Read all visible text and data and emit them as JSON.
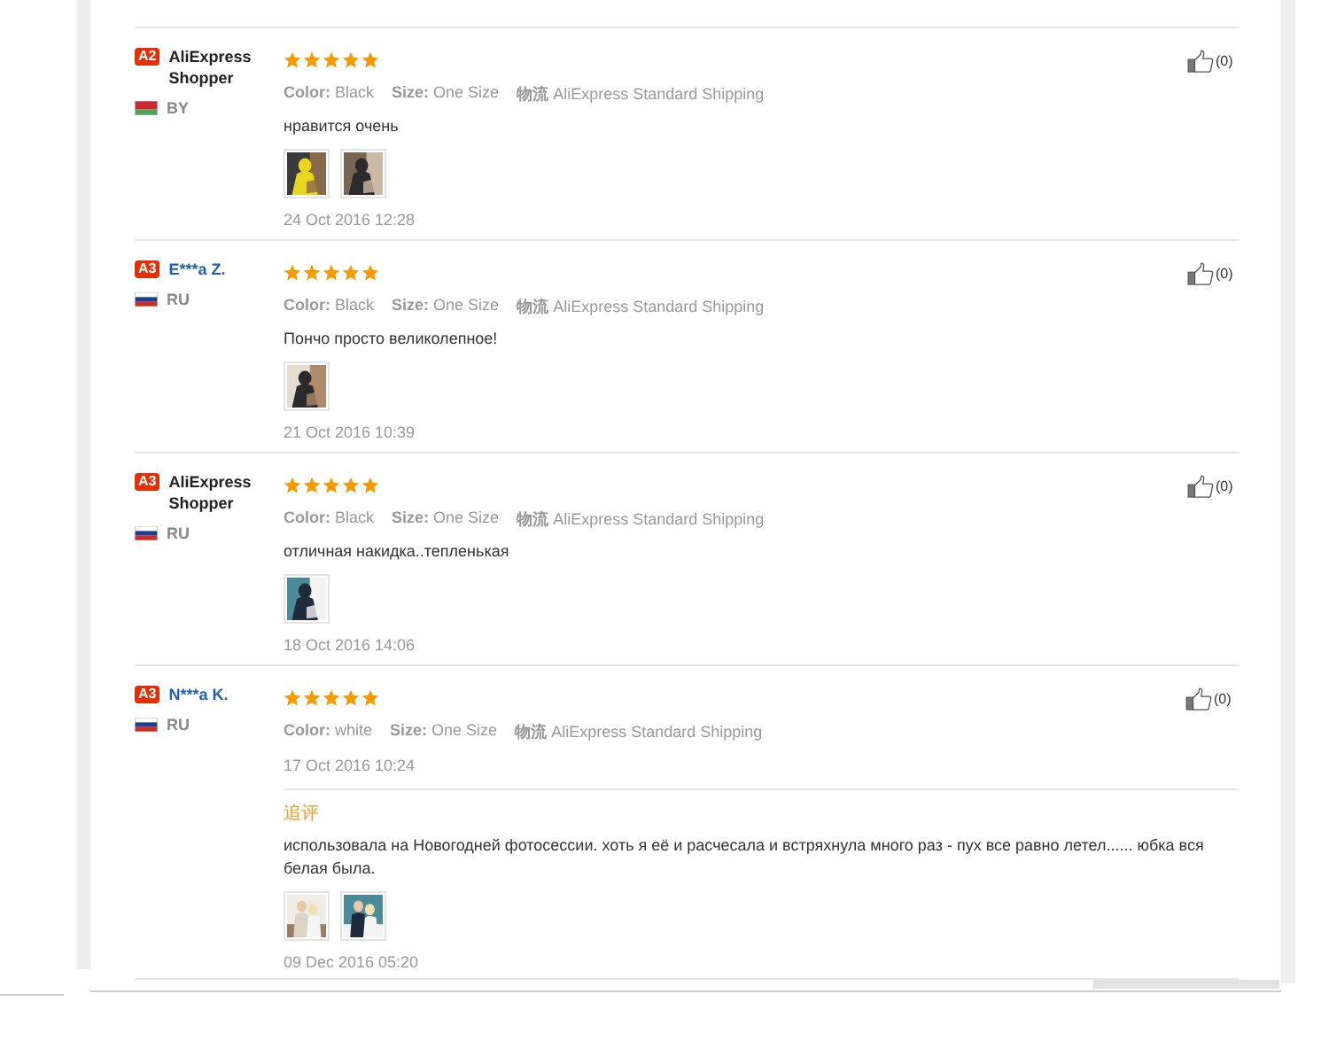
{
  "reviews": [
    {
      "badge": "A2",
      "name": "AliExpress Shopper",
      "link": false,
      "country": {
        "code": "BY",
        "kind": "by"
      },
      "stars": 5,
      "attributes": [
        {
          "label": "Color:",
          "value": "Black"
        },
        {
          "label": "Size:",
          "value": "One Size"
        },
        {
          "label": "物流",
          "value": "AliExpress Standard Shipping"
        }
      ],
      "text": "нравится очень",
      "photos": [
        {
          "kind": "picture"
        },
        {
          "kind": "picture"
        }
      ],
      "date": "24 Oct 2016 12:28",
      "likes": "(0)"
    },
    {
      "badge": "A3",
      "name": "E***a Z.",
      "link": true,
      "country": {
        "code": "RU",
        "kind": "ru"
      },
      "stars": 5,
      "attributes": [
        {
          "label": "Color:",
          "value": "Black"
        },
        {
          "label": "Size:",
          "value": "One Size"
        },
        {
          "label": "物流",
          "value": "AliExpress Standard Shipping"
        }
      ],
      "text": "Пончо просто великолепное!",
      "photos": [
        {
          "kind": "picture"
        }
      ],
      "date": "21 Oct 2016 10:39",
      "likes": "(0)"
    },
    {
      "badge": "A3",
      "name": "AliExpress Shopper",
      "link": false,
      "country": {
        "code": "RU",
        "kind": "ru"
      },
      "stars": 5,
      "attributes": [
        {
          "label": "Color:",
          "value": "Black"
        },
        {
          "label": "Size:",
          "value": "One Size"
        },
        {
          "label": "物流",
          "value": "AliExpress Standard Shipping"
        }
      ],
      "text": "отличная накидка..тепленькая",
      "photos": [
        {
          "kind": "picture"
        }
      ],
      "date": "18 Oct 2016 14:06",
      "likes": "(0)"
    },
    {
      "badge": "A3",
      "name": "N***a K.",
      "link": true,
      "country": {
        "code": "RU",
        "kind": "ru"
      },
      "stars": 5,
      "attributes": [
        {
          "label": "Color:",
          "value": "white"
        },
        {
          "label": "Size:",
          "value": "One Size"
        },
        {
          "label": "物流",
          "value": "AliExpress Standard Shipping"
        }
      ],
      "date": "17 Oct 2016 10:24",
      "likes": "(0)",
      "followup": {
        "label": "追评",
        "text": "использовала на Новогодней фотосессии. хоть я её и расчесала и встряхнула много раз - пух все равно летел...... юбка вся белая была.",
        "photos": [
          {
            "kind": "picture"
          },
          {
            "kind": "picture"
          }
        ],
        "date": "09 Dec 2016 05:20"
      }
    }
  ]
}
